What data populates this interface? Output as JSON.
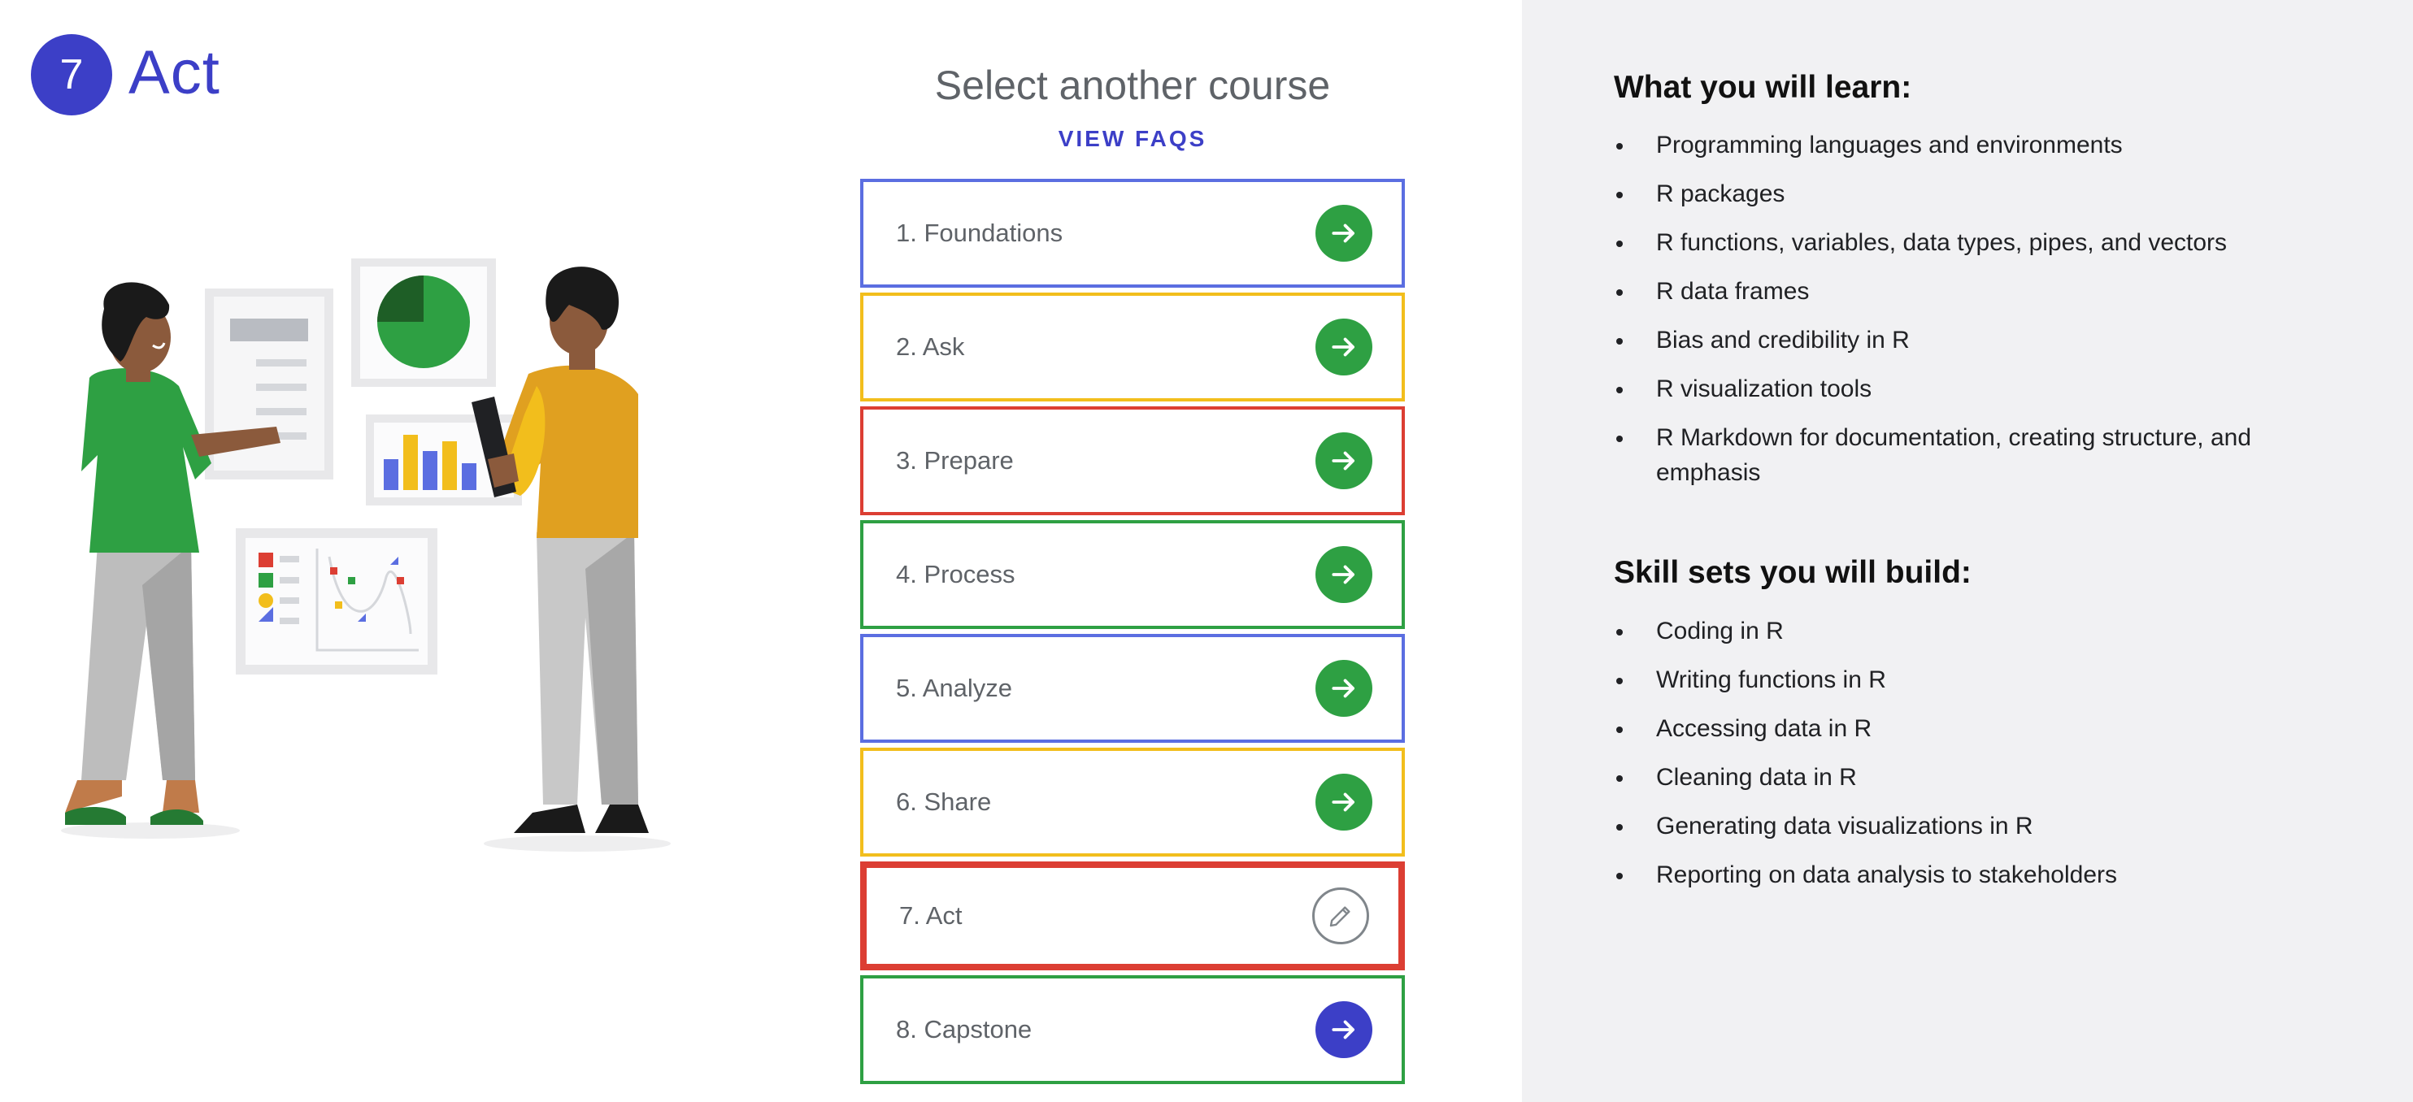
{
  "header": {
    "badge": "7",
    "title": "Act"
  },
  "course_selector": {
    "title": "Select another course",
    "faq_link": "VIEW FAQS",
    "courses": [
      {
        "label": "1. Foundations",
        "border_color": "#5b6ee1",
        "button_color": "#2ea043",
        "icon": "arrow-right-icon"
      },
      {
        "label": "2. Ask",
        "border_color": "#f2be1c",
        "button_color": "#2ea043",
        "icon": "arrow-right-icon"
      },
      {
        "label": "3. Prepare",
        "border_color": "#dc3e33",
        "button_color": "#2ea043",
        "icon": "arrow-right-icon"
      },
      {
        "label": "4. Process",
        "border_color": "#2ea043",
        "button_color": "#2ea043",
        "icon": "arrow-right-icon"
      },
      {
        "label": "5. Analyze",
        "border_color": "#5b6ee1",
        "button_color": "#2ea043",
        "icon": "arrow-right-icon"
      },
      {
        "label": "6. Share",
        "border_color": "#f2be1c",
        "button_color": "#2ea043",
        "icon": "arrow-right-icon"
      },
      {
        "label": "7. Act",
        "border_color": "#dc3e33",
        "button_color": "#ffffff",
        "icon": "pencil-icon"
      },
      {
        "label": "8. Capstone",
        "border_color": "#2ea043",
        "button_color": "#3c3fc7",
        "icon": "arrow-right-icon"
      }
    ]
  },
  "learn": {
    "heading": "What you will learn:",
    "items": [
      "Programming languages and environments",
      "R packages",
      "R functions, variables, data types, pipes, and vectors",
      "R data frames",
      "Bias and credibility in R",
      "R visualization tools",
      "R Markdown for documentation, creating structure, and emphasis"
    ]
  },
  "skills": {
    "heading": "Skill sets you will build:",
    "items": [
      "Coding in R",
      "Writing functions in R",
      "Accessing data in R",
      "Cleaning data in R",
      "Generating data visualizations in R",
      "Reporting on data analysis to stakeholders"
    ]
  },
  "colors": {
    "brand": "#3c3fc7",
    "panel_bg": "#f1f1f3"
  }
}
